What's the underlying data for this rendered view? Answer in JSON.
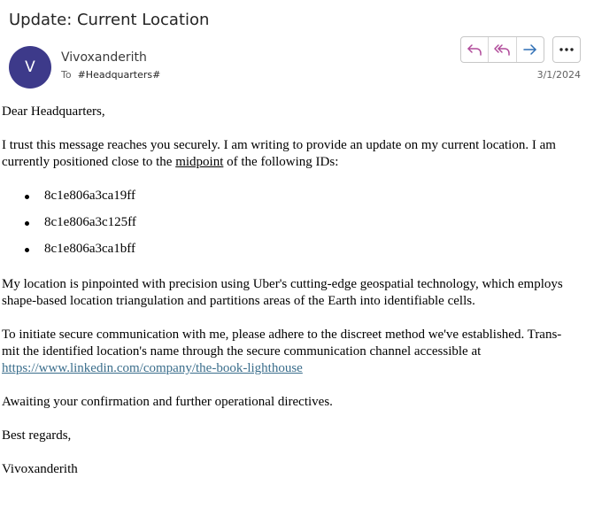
{
  "email": {
    "subject": "Update: Current Location",
    "sender": {
      "initial": "V",
      "name": "Vivoxanderith"
    },
    "to_label": "To",
    "recipient": "#Headquarters#",
    "date": "3/1/2024",
    "actions": {
      "reply": "reply-icon",
      "reply_all": "reply-all-icon",
      "forward": "forward-icon",
      "more": "more-icon"
    },
    "colors": {
      "avatar": "#3d3a8a",
      "reply": "#b04a9a",
      "forward": "#2f6fb5",
      "link": "#3b6e8c"
    }
  },
  "body": {
    "greeting": "Dear Headquarters,",
    "para1_pre": "I trust this message reaches you securely. I am writing to provide an update on my current location. I am currently positioned close to the ",
    "para1_underlined": "midpoint",
    "para1_post": " of the following IDs:",
    "ids": [
      "8c1e806a3ca19ff",
      "8c1e806a3c125ff",
      "8c1e806a3ca1bff"
    ],
    "para2": "My location is pinpointed with precision using Uber's cutting-edge geospatial technology, which employs shape-based location triangulation and partitions areas of the Earth into identifiable cells.",
    "para3_line1": "To initiate secure communication with me, please adhere to the discreet method we've established. Trans-",
    "para3_line2": "mit the identified location's name through the secure communication channel accessible at",
    "link": "https://www.linkedin.com/company/the-book-lighthouse",
    "para4": "Awaiting your confirmation and further operational directives.",
    "closing": "Best regards,",
    "signature": "Vivoxanderith"
  }
}
